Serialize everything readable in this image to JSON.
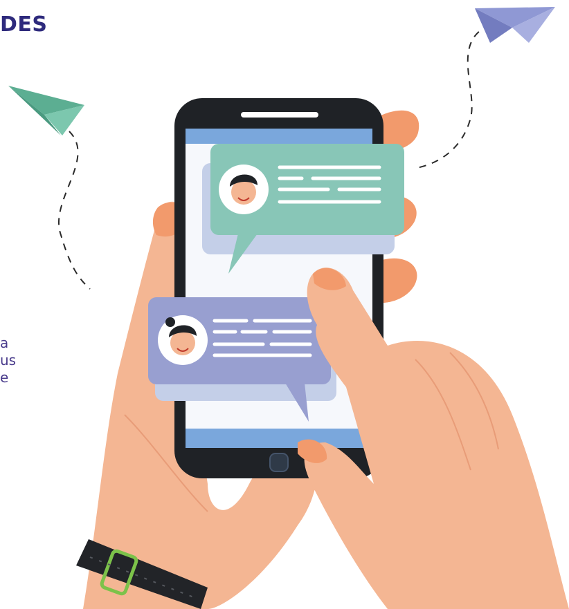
{
  "heading": {
    "text": "DES"
  },
  "body_lines": [
    "a",
    "us",
    "e"
  ],
  "colors": {
    "heading": "#2e2a7c",
    "body_text": "#4a3c8c",
    "skin": "#f4b693",
    "skin_shadow": "#f29a6c",
    "phone_body": "#1f2226",
    "screen_bar": "#7aa7dc",
    "bubble_green": "#88c6b7",
    "bubble_purple": "#989fd0",
    "bubble_shadow": "#c4cfe8",
    "plane_green": "#5cae92",
    "plane_purple": "#8f98d4",
    "watch_band": "#222428",
    "watch_buckle": "#7cc24a"
  },
  "illustration": {
    "icons": [
      "paper-plane-icon",
      "paper-plane-icon",
      "avatar-boy-icon",
      "avatar-girl-icon"
    ]
  }
}
